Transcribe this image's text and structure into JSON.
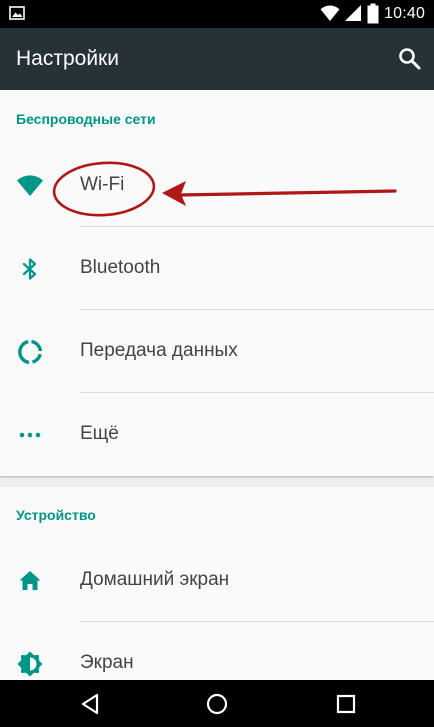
{
  "status_bar": {
    "time": "10:40"
  },
  "toolbar": {
    "title": "Настройки"
  },
  "sections": {
    "wireless": {
      "header": "Беспроводные сети",
      "items": [
        {
          "label": "Wi-Fi",
          "icon": "wifi-icon"
        },
        {
          "label": "Bluetooth",
          "icon": "bluetooth-icon"
        },
        {
          "label": "Передача данных",
          "icon": "data-usage-icon"
        },
        {
          "label": "Ещё",
          "icon": "more-icon"
        }
      ]
    },
    "device": {
      "header": "Устройство",
      "items": [
        {
          "label": "Домашний экран",
          "icon": "home-icon"
        },
        {
          "label": "Экран",
          "icon": "brightness-icon"
        }
      ]
    }
  },
  "colors": {
    "accent": "#009688",
    "toolbar": "#263238",
    "annotation": "#b01818",
    "text": "#444444"
  }
}
